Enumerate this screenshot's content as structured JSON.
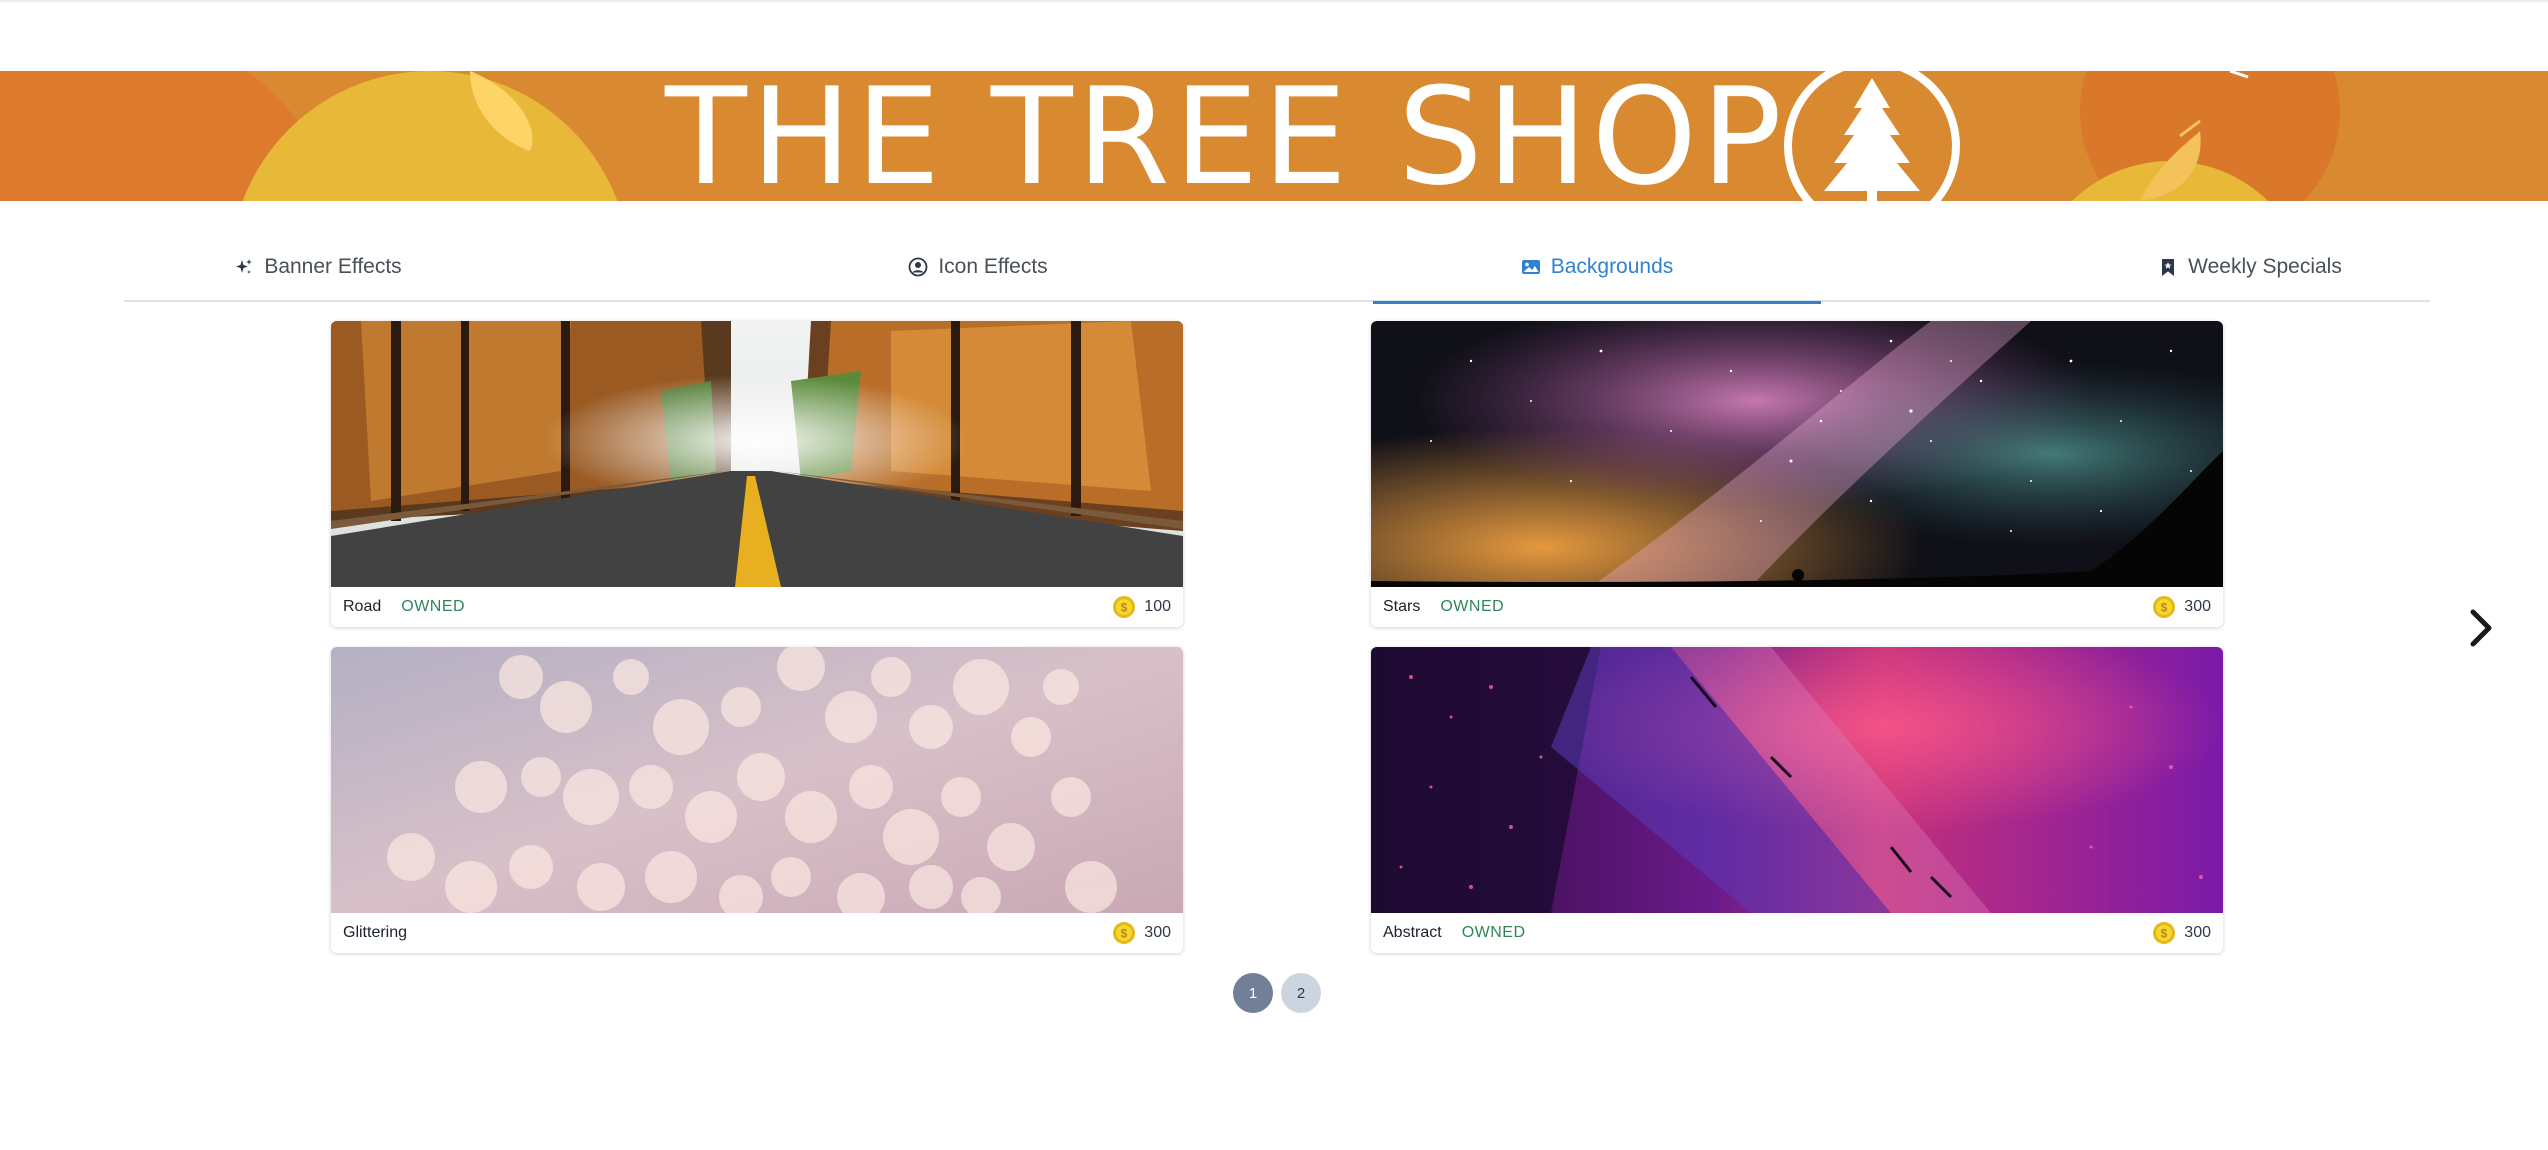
{
  "banner": {
    "title": "THE TREE SHOP",
    "colors": {
      "background": "#d98a30",
      "accent_red": "#c9542c",
      "accent_yellow": "#e8b838"
    }
  },
  "tabs": [
    {
      "label": "Banner Effects",
      "icon": "sparkles-icon",
      "active": false
    },
    {
      "label": "Icon Effects",
      "icon": "user-circle-icon",
      "active": false
    },
    {
      "label": "Backgrounds",
      "icon": "image-icon",
      "active": true
    },
    {
      "label": "Weekly Specials",
      "icon": "bookmark-icon",
      "active": false
    }
  ],
  "items": [
    {
      "name": "Road",
      "owned_label": "OWNED",
      "price": "100",
      "image": "autumn-road-image"
    },
    {
      "name": "Stars",
      "owned_label": "OWNED",
      "price": "300",
      "image": "milky-way-image"
    },
    {
      "name": "Glittering",
      "owned_label": "",
      "price": "300",
      "image": "bokeh-image"
    },
    {
      "name": "Abstract",
      "owned_label": "OWNED",
      "price": "300",
      "image": "abstract-purple-image"
    }
  ],
  "pagination": {
    "pages": [
      "1",
      "2"
    ],
    "current": "1"
  },
  "icons": {
    "coin": "coin-icon",
    "next": "chevron-right-icon"
  },
  "colors": {
    "active_tab": "#3182ce",
    "owned": "#2f855a",
    "page_active": "#718096",
    "page_inactive": "#cbd5e0"
  }
}
